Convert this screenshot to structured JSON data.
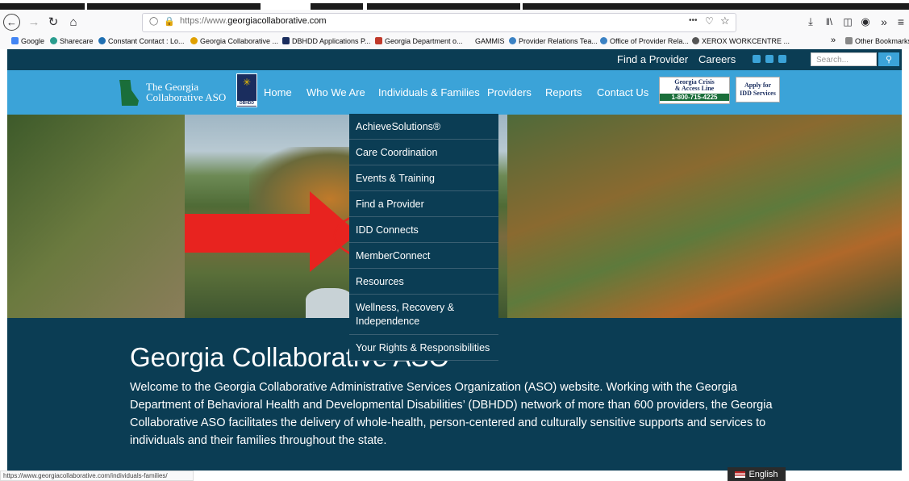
{
  "browser": {
    "url_prefix": "https://www.",
    "url_domain": "georgiacollaborative.com",
    "menu_dots": "•••",
    "status_url": "https://www.georgiacollaborative.com/individuals-families/",
    "bookmarks": [
      {
        "label": "Google",
        "color": "#4285f4"
      },
      {
        "label": "Sharecare",
        "color": "#2a9d8f"
      },
      {
        "label": "Constant Contact : Lo...",
        "color": "#1f6fb2"
      },
      {
        "label": "Georgia Collaborative ...",
        "color": "#e0a000"
      },
      {
        "label": "DBHDD Applications P...",
        "color": "#1a2d5e"
      },
      {
        "label": "Georgia Department o...",
        "color": "#c0392b"
      },
      {
        "label": "GAMMIS",
        "color": ""
      },
      {
        "label": "Provider Relations Tea...",
        "color": "#3b82c4"
      },
      {
        "label": "Office of Provider Rela...",
        "color": "#3b82c4"
      },
      {
        "label": "XEROX WORKCENTRE ...",
        "color": "#555555"
      }
    ],
    "other_bookmarks": "Other Bookmarks"
  },
  "site": {
    "top_links": {
      "find_provider": "Find a Provider",
      "careers": "Careers"
    },
    "search_placeholder": "Search...",
    "logo_line1": "The Georgia",
    "logo_line2": "Collaborative ASO",
    "dbhdd_label": "DBHDD",
    "nav": [
      "Home",
      "Who We Are",
      "Individuals & Families",
      "Providers",
      "Reports",
      "Contact Us"
    ],
    "crisis": {
      "line1": "Georgia Crisis",
      "line2": "& Access Line",
      "phone": "1-800-715-4225"
    },
    "idd_button": {
      "line1": "Apply for",
      "line2": "IDD Services"
    },
    "dropdown": [
      "AchieveSolutions®",
      "Care Coordination",
      "Events & Training",
      "Find a Provider",
      "IDD Connects",
      "MemberConnect",
      "Resources",
      "Wellness, Recovery & Independence",
      "Your Rights & Responsibilities"
    ],
    "welcome_title": "Georgia Collaborative ASO",
    "welcome_body": "Welcome to the Georgia Collaborative Administrative Services Organization (ASO) website. Working with the Georgia Department of Behavioral Health and Developmental Disabilities’ (DBHDD) network of more than 600 providers, the Georgia Collaborative ASO facilitates the delivery of whole-health, person-centered and culturally sensitive supports and services to individuals and their families throughout the state.",
    "language": "English"
  },
  "colors": {
    "dark_teal": "#0b3d54",
    "nav_blue": "#3ba3d8",
    "annotation_red": "#e8231f"
  }
}
